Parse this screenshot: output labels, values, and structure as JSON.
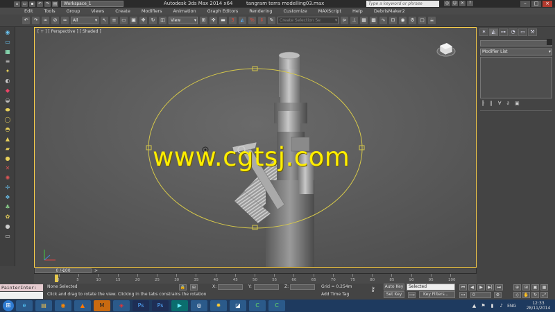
{
  "titlebar": {
    "workspace": "Workspace_1",
    "app_title": "Autodesk 3ds Max  2014 x64",
    "document_title": "tangram terra modelling03.max",
    "search_placeholder": "Type a keyword or phrase"
  },
  "menu": {
    "items": [
      "Edit",
      "Tools",
      "Group",
      "Views",
      "Create",
      "Modifiers",
      "Animation",
      "Graph Editors",
      "Rendering",
      "Customize",
      "MAXScript",
      "Help",
      "DebrisMaker2"
    ]
  },
  "toolbar": {
    "filter_dropdown": "All",
    "reference_coord": "View",
    "named_selection": "Create Selection Se",
    "icons": [
      "undo-icon",
      "redo-icon",
      "link-icon",
      "unlink-icon",
      "bind-icon",
      "select-icon",
      "select-by-name-icon",
      "rect-select-icon",
      "window-crossing-icon",
      "move-icon",
      "rotate-icon",
      "scale-icon",
      "pivot-icon",
      "select-manipulate-icon",
      "keyboard-shortcut-icon",
      "snap-3-icon",
      "angle-snap-icon",
      "percent-snap-icon",
      "spinner-snap-icon",
      "edit-named-icon",
      "mirror-icon",
      "align-icon",
      "layer-icon",
      "graphite-icon",
      "curve-editor-icon",
      "schematic-icon",
      "material-editor-icon",
      "render-setup-icon",
      "rendered-frame-icon",
      "render-icon"
    ]
  },
  "viewport": {
    "label": "[ + ] [ Perspective ] [ Shaded ]",
    "watermark": "www.cgtsj.com"
  },
  "command_panel": {
    "modifier_list": "Modifier List",
    "stack_buttons": [
      "┠",
      "‖",
      "∀",
      "∂",
      "▣"
    ]
  },
  "time_slider": {
    "frame_display": "0 / 100",
    "prev_arrow": "<",
    "next_arrow": ">"
  },
  "trackbar": {
    "ticks": [
      "0",
      "5",
      "10",
      "15",
      "20",
      "25",
      "30",
      "35",
      "40",
      "45",
      "50",
      "55",
      "60",
      "65",
      "70",
      "75",
      "80",
      "85",
      "90",
      "95",
      "100"
    ]
  },
  "status": {
    "maxscript_label": "PainterInter:",
    "selection": "None Selected",
    "prompt": "Click and drag to rotate the view.  Clicking in the tabs constrains the rotation",
    "x_label": "X:",
    "y_label": "Y:",
    "z_label": "Z:",
    "grid": "Grid = 0.254m",
    "add_time_tag": "Add Time Tag",
    "auto_key": "Auto Key",
    "set_key": "Set Key",
    "selected_dropdown": "Selected",
    "key_filters": "Key Filters...",
    "frame_value": "0"
  },
  "taskbar": {
    "apps": [
      "ie-icon",
      "explorer-icon",
      "firefox-icon",
      "vlc-icon",
      "mudbox-icon",
      "3dsmax-red-icon",
      "photoshop-icon",
      "photoshop2-icon",
      "3dsmax-icon",
      "app-icon",
      "paint-icon",
      "app2-icon",
      "camtasia-icon",
      "camtasia2-icon"
    ],
    "language": "ENG",
    "time": "12:33",
    "date": "28/11/2014"
  },
  "colors": {
    "selection_gizmo": "#d6c84a",
    "watermark": "#ffee00",
    "viewport_border": "#ffd24a"
  }
}
